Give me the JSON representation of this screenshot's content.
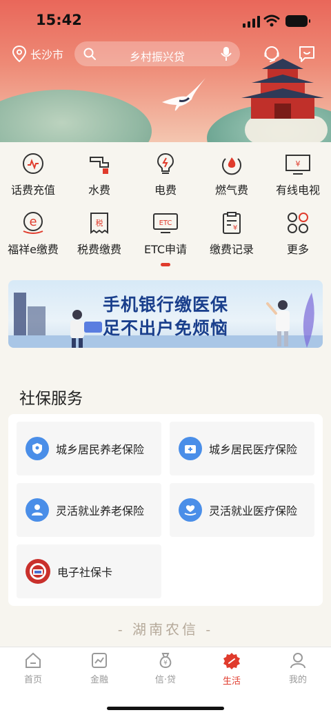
{
  "status": {
    "time": "15:42"
  },
  "header": {
    "location": "长沙市",
    "search_placeholder": "乡村振兴贷"
  },
  "services": [
    {
      "label": "话费充值",
      "icon": "phone-bill-icon"
    },
    {
      "label": "水费",
      "icon": "water-tap-icon"
    },
    {
      "label": "电费",
      "icon": "lightbulb-icon"
    },
    {
      "label": "燃气费",
      "icon": "flame-icon"
    },
    {
      "label": "有线电视",
      "icon": "tv-icon"
    },
    {
      "label": "福祥e缴费",
      "icon": "e-pay-icon"
    },
    {
      "label": "税费缴费",
      "icon": "tax-receipt-icon"
    },
    {
      "label": "ETC申请",
      "icon": "etc-card-icon"
    },
    {
      "label": "缴费记录",
      "icon": "payment-record-icon"
    },
    {
      "label": "更多",
      "icon": "more-grid-icon"
    }
  ],
  "banner": {
    "line1": "手机银行缴医保",
    "line2": "足不出户免烦恼"
  },
  "social": {
    "title": "社保服务",
    "items": [
      {
        "label": "城乡居民养老保险",
        "icon": "shield-person-icon"
      },
      {
        "label": "城乡居民医疗保险",
        "icon": "medical-kit-icon"
      },
      {
        "label": "灵活就业养老保险",
        "icon": "person-icon"
      },
      {
        "label": "灵活就业医疗保险",
        "icon": "hand-heart-icon"
      },
      {
        "label": "电子社保卡",
        "icon": "social-security-card-icon"
      }
    ]
  },
  "brand_footer": "- 湖南农信 -",
  "tabs": [
    {
      "label": "首页",
      "icon": "home-icon"
    },
    {
      "label": "金融",
      "icon": "finance-chart-icon"
    },
    {
      "label": "信·贷",
      "icon": "money-bag-icon"
    },
    {
      "label": "生活",
      "icon": "life-icon",
      "active": true
    },
    {
      "label": "我的",
      "icon": "profile-icon"
    }
  ],
  "colors": {
    "accent": "#e03b2c",
    "hero_top": "#e9675a",
    "banner_text": "#1a3f8c",
    "card_icon": "#4a8ee8"
  }
}
